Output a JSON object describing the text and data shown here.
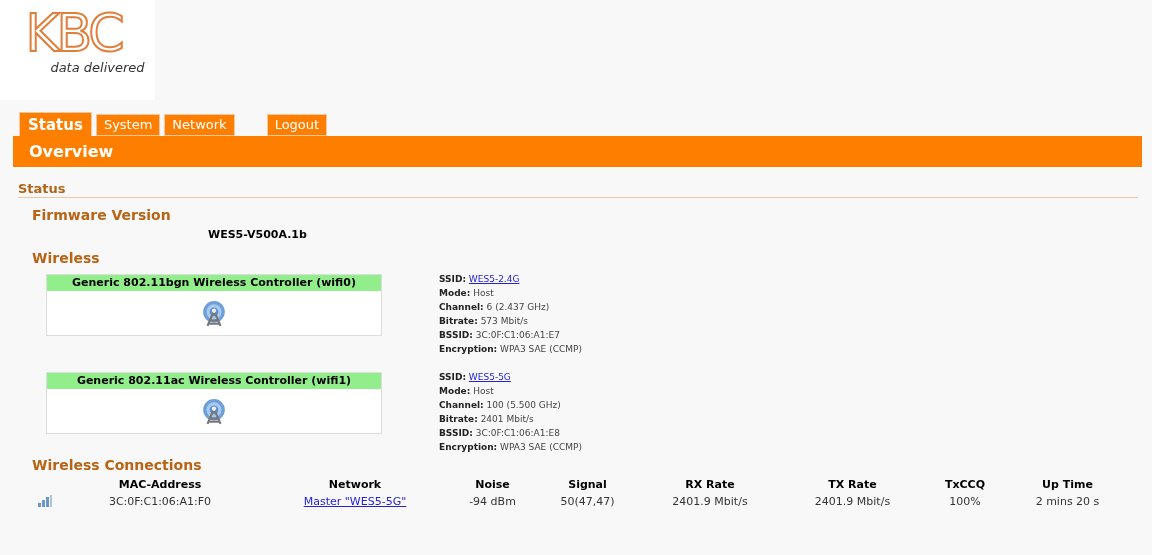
{
  "logo": {
    "mark": "KBC",
    "tagline": "data delivered"
  },
  "tabs": [
    {
      "label": "Status",
      "kind": "tab",
      "selected": true
    },
    {
      "label": "System",
      "kind": "tab",
      "selected": false
    },
    {
      "label": "Network",
      "kind": "tab",
      "selected": false
    },
    {
      "label": "Logout",
      "kind": "action",
      "selected": false
    }
  ],
  "page_title": "Overview",
  "section_title": "Status",
  "firmware": {
    "heading": "Firmware Version",
    "value": "WES5-V500A.1b"
  },
  "wireless": {
    "heading": "Wireless",
    "radios": [
      {
        "name": "Generic 802.11bgn Wireless Controller (wifi0)",
        "info": [
          {
            "label": "SSID:",
            "value": "WES5-2.4G",
            "kind": "link"
          },
          {
            "label": "Mode:",
            "value": "Host",
            "kind": "text"
          },
          {
            "label": "Channel:",
            "value": "6 (2.437 GHz)",
            "kind": "text"
          },
          {
            "label": "Bitrate:",
            "value": "573 Mbit/s",
            "kind": "text"
          },
          {
            "label": "BSSID:",
            "value": "3C:0F:C1:06:A1:E7",
            "kind": "text"
          },
          {
            "label": "Encryption:",
            "value": "WPA3 SAE (CCMP)",
            "kind": "text"
          }
        ]
      },
      {
        "name": "Generic 802.11ac Wireless Controller (wifi1)",
        "info": [
          {
            "label": "SSID:",
            "value": "WES5-5G",
            "kind": "link"
          },
          {
            "label": "Mode:",
            "value": "Host",
            "kind": "text"
          },
          {
            "label": "Channel:",
            "value": "100 (5.500 GHz)",
            "kind": "text"
          },
          {
            "label": "Bitrate:",
            "value": "2401 Mbit/s",
            "kind": "text"
          },
          {
            "label": "BSSID:",
            "value": "3C:0F:C1:06:A1:E8",
            "kind": "text"
          },
          {
            "label": "Encryption:",
            "value": "WPA3 SAE (CCMP)",
            "kind": "text"
          }
        ]
      }
    ]
  },
  "connections": {
    "heading": "Wireless Connections",
    "columns": [
      "MAC-Address",
      "Network",
      "Noise",
      "Signal",
      "RX Rate",
      "TX Rate",
      "TxCCQ",
      "Up Time"
    ],
    "rows": [
      {
        "cells": [
          {
            "text": "3C:0F:C1:06:A1:F0",
            "kind": "text"
          },
          {
            "text": "Master \"WES5-5G\"",
            "kind": "link"
          },
          {
            "text": "-94 dBm",
            "kind": "text"
          },
          {
            "text": "50(47,47)",
            "kind": "text"
          },
          {
            "text": "2401.9 Mbit/s",
            "kind": "text"
          },
          {
            "text": "2401.9 Mbit/s",
            "kind": "text"
          },
          {
            "text": "100%",
            "kind": "text"
          },
          {
            "text": "2 mins 20 s",
            "kind": "text"
          }
        ]
      }
    ]
  }
}
